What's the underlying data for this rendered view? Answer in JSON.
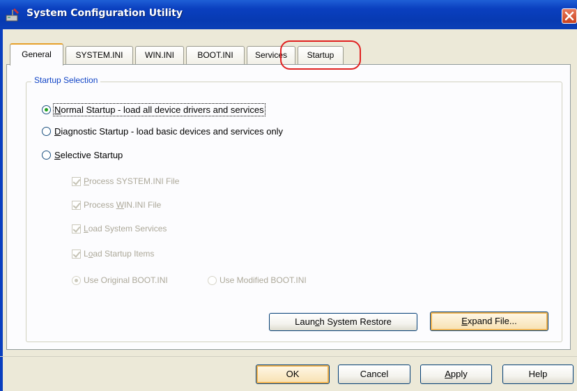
{
  "window": {
    "title": "System Configuration Utility",
    "close_label": "close"
  },
  "tabs": [
    {
      "label": "General",
      "active": true
    },
    {
      "label": "SYSTEM.INI",
      "active": false
    },
    {
      "label": "WIN.INI",
      "active": false
    },
    {
      "label": "BOOT.INI",
      "active": false
    },
    {
      "label": "Services",
      "active": false
    },
    {
      "label": "Startup",
      "active": false
    }
  ],
  "group": {
    "legend": "Startup Selection"
  },
  "radios": {
    "normal": {
      "pre": "",
      "ul": "N",
      "post": "ormal Startup - load all device drivers and services",
      "checked": true
    },
    "diagnostic": {
      "pre": "",
      "ul": "D",
      "post": "iagnostic Startup - load basic devices and services only",
      "checked": false
    },
    "selective": {
      "pre": "",
      "ul": "S",
      "post": "elective Startup",
      "checked": false
    }
  },
  "checks": {
    "system_ini": {
      "pre": "",
      "ul": "P",
      "post": "rocess SYSTEM.INI File",
      "checked": true
    },
    "win_ini": {
      "pre": "Process ",
      "ul": "W",
      "post": "IN.INI File",
      "checked": true
    },
    "services": {
      "pre": "",
      "ul": "L",
      "post": "oad System Services",
      "checked": true
    },
    "startup_items": {
      "pre": "L",
      "ul": "o",
      "post": "ad Startup Items",
      "checked": true
    }
  },
  "boot_options": {
    "original": "Use Original BOOT.INI",
    "modified": "Use Modified BOOT.INI"
  },
  "buttons": {
    "restore": {
      "pre": "Laun",
      "ul": "c",
      "post": "h System Restore"
    },
    "expand": {
      "pre": "",
      "ul": "E",
      "post": "xpand File..."
    },
    "ok": "OK",
    "cancel": "Cancel",
    "apply": {
      "pre": "",
      "ul": "A",
      "post": "pply"
    },
    "help": "Help"
  },
  "colors": {
    "titlebar": "#0a3fbf",
    "accent_orange": "#e6a02a",
    "highlight_red": "#e02020",
    "legend_blue": "#1044c6"
  }
}
